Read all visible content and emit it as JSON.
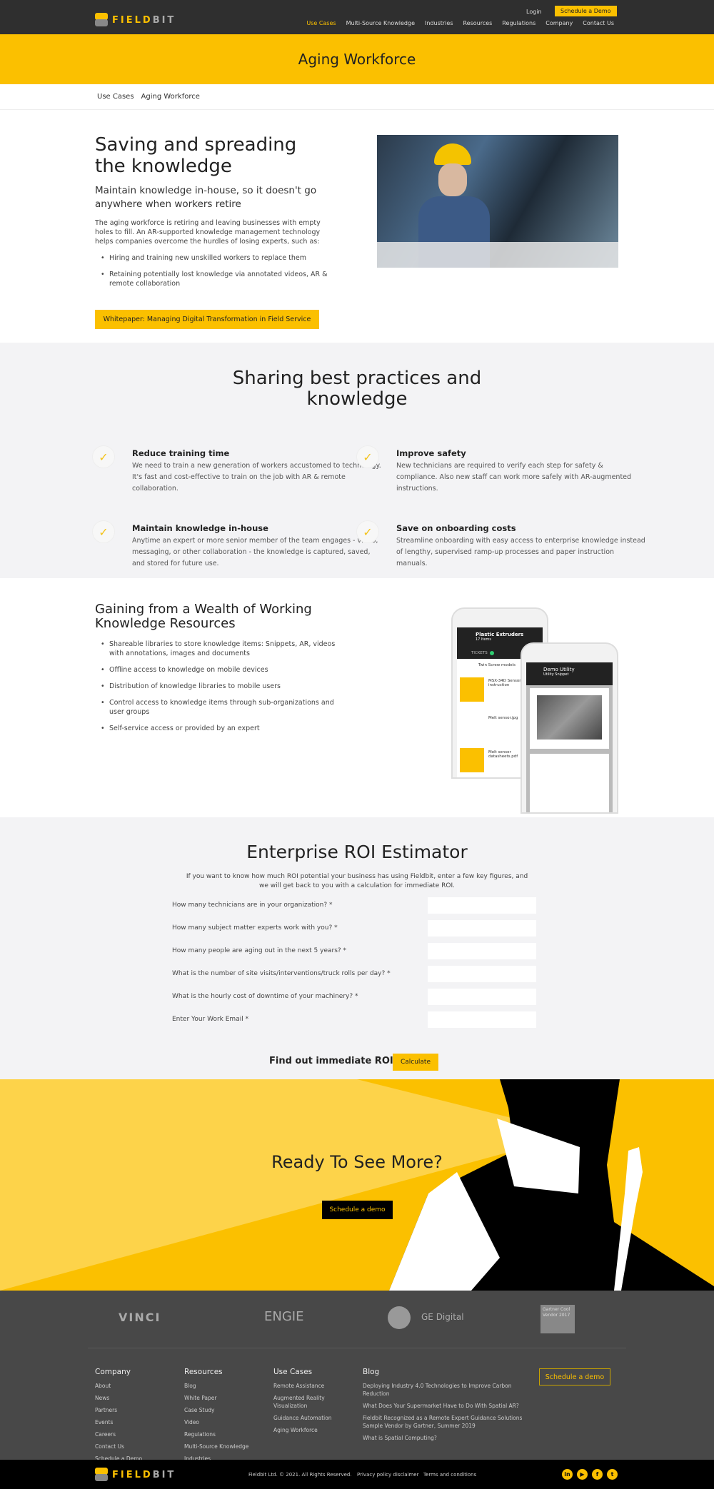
{
  "header": {
    "logo": "FIELDBIT",
    "login": "Login",
    "schedule_demo": "Schedule a Demo",
    "nav": [
      "Use Cases",
      "Multi-Source Knowledge",
      "Industries",
      "Resources",
      "Regulations",
      "Company",
      "Contact Us"
    ]
  },
  "banner": {
    "title": "Aging Workforce"
  },
  "breadcrumb": [
    "Use Cases",
    "Aging Workforce"
  ],
  "hero": {
    "title": "Saving and spreading the knowledge",
    "subtitle": "Maintain knowledge in-house, so it doesn't go anywhere when workers retire",
    "body": "The aging workforce is retiring and leaving businesses with empty holes to fill. An AR-supported knowledge management technology helps companies overcome the hurdles of losing experts, such as:",
    "bullets": [
      "Hiring and training new unskilled workers to replace them",
      "Retaining potentially lost knowledge via annotated videos, AR & remote collaboration"
    ],
    "button": "Whitepaper: Managing Digital Transformation in Field Service"
  },
  "sharing": {
    "title": "Sharing best practices and knowledge",
    "features": [
      {
        "title": "Reduce training time",
        "text": "We need to train a new generation of workers accustomed to technology. It's fast and cost-effective to train on the job with AR & remote collaboration."
      },
      {
        "title": "Improve safety",
        "text": "New technicians are required to verify each step for safety & compliance. Also new staff can work more safely with AR-augmented instructions."
      },
      {
        "title": "Maintain knowledge in-house",
        "text": "Anytime an expert or more senior member of the team engages - video, messaging, or other collaboration - the knowledge is captured, saved, and stored for future use."
      },
      {
        "title": "Save on onboarding costs",
        "text": "Streamline onboarding with easy access to enterprise knowledge instead of lengthy, supervised ramp-up processes and paper instruction manuals."
      }
    ]
  },
  "wealth": {
    "title": "Gaining from a Wealth of Working Knowledge Resources",
    "bullets": [
      "Shareable libraries to store knowledge items: Snippets, AR, videos with annotations, images and documents",
      "Offline access to knowledge on mobile devices",
      "Distribution of knowledge libraries to mobile users",
      "Control access to knowledge items through sub-organizations and user groups",
      "Self-service access or provided by an expert"
    ],
    "phone1": {
      "title": "Plastic Extruders",
      "sub": "17 Items",
      "tab": "TICKETS",
      "items": [
        "Twin Screw models",
        "MSX-34D Sensor Reality instruction",
        "Melt sensor.jpg",
        "Melt sensor datasheets.pdf"
      ]
    },
    "phone2": {
      "title": "Demo Utility",
      "sub": "Utility Snippet"
    }
  },
  "roi": {
    "title": "Enterprise ROI Estimator",
    "intro": "If you want to know how much ROI potential your business has using Fieldbit, enter a few key figures, and we will get back to you with a calculation for immediate ROI.",
    "fields": [
      "How many technicians are in your organization? *",
      "How many subject matter experts work with you? *",
      "How many people are aging out in the next 5 years? *",
      "What is the number of site visits/interventions/truck rolls per day? *",
      "What is the hourly cost of downtime of your machinery? *",
      "Enter Your Work Email *"
    ],
    "cta_label": "Find out immediate ROI",
    "button": "Calculate"
  },
  "cta": {
    "title": "Ready To See More?",
    "button": "Schedule a demo"
  },
  "logos": [
    "VINCI",
    "ENGIE",
    "GE Digital",
    "Gartner Cool Vendor 2017"
  ],
  "footer": {
    "columns": [
      {
        "title": "Company",
        "links": [
          "About",
          "News",
          "Partners",
          "Events",
          "Careers",
          "Contact Us",
          "Schedule a Demo"
        ]
      },
      {
        "title": "Resources",
        "links": [
          "Blog",
          "White Paper",
          "Case Study",
          "Video",
          "Regulations",
          "Multi-Source Knowledge",
          "Industries"
        ]
      },
      {
        "title": "Use Cases",
        "links": [
          "Remote Assistance",
          "Augmented Reality Visualization",
          "Guidance Automation",
          "Aging Workforce"
        ]
      },
      {
        "title": "Blog",
        "links": [
          "Deploying Industry 4.0 Technologies to Improve Carbon Reduction",
          "What Does Your Supermarket Have to Do With Spatial AR?",
          "Fieldbit Recognized as a Remote Expert Guidance Solutions Sample Vendor by Gartner, Summer 2019",
          "What is Spatial Computing?"
        ]
      }
    ],
    "demo_button": "Schedule a demo",
    "copyright": "Fieldbit Ltd. © 2021. All Rights Reserved.",
    "privacy": "Privacy policy disclaimer",
    "terms": "Terms and conditions",
    "social": [
      "linkedin",
      "youtube",
      "facebook",
      "twitter"
    ]
  },
  "colors": {
    "accent": "#fbc000",
    "dark": "#2f2f2f",
    "footer": "#484848"
  }
}
